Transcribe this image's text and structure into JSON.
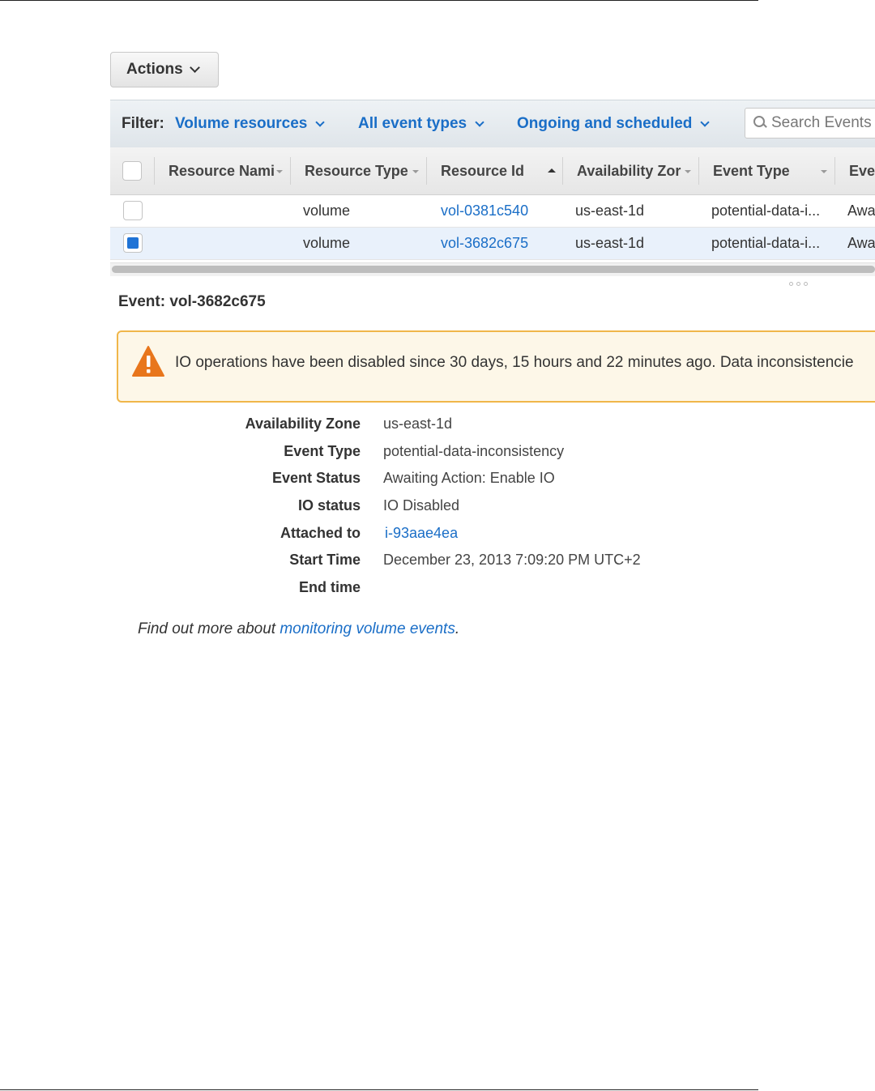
{
  "toolbar": {
    "actions_label": "Actions"
  },
  "filter": {
    "label": "Filter:",
    "resources": "Volume resources",
    "event_types": "All event types",
    "status": "Ongoing and scheduled",
    "search_placeholder": "Search Events"
  },
  "table": {
    "headers": {
      "resource_name": "Resource Nami",
      "resource_type": "Resource Type",
      "resource_id": "Resource Id",
      "availability_zone": "Availability Zor",
      "event_type": "Event Type",
      "event_status": "Eve"
    },
    "rows": [
      {
        "selected": false,
        "resource_name": "",
        "resource_type": "volume",
        "resource_id": "vol-0381c540",
        "availability_zone": "us-east-1d",
        "event_type": "potential-data-i...",
        "event_status": "Awa"
      },
      {
        "selected": true,
        "resource_name": "",
        "resource_type": "volume",
        "resource_id": "vol-3682c675",
        "availability_zone": "us-east-1d",
        "event_type": "potential-data-i...",
        "event_status": "Awa"
      }
    ]
  },
  "event": {
    "title": "Event: vol-3682c675",
    "warning": "IO operations have been disabled since 30 days, 15 hours and 22 minutes ago. Data inconsistencie",
    "details": [
      {
        "label": "Availability Zone",
        "value": "us-east-1d"
      },
      {
        "label": "Event Type",
        "value": "potential-data-inconsistency"
      },
      {
        "label": "Event Status",
        "value": "Awaiting Action: Enable IO"
      },
      {
        "label": "IO status",
        "value": "IO Disabled"
      },
      {
        "label": "Attached to",
        "value": "i-93aae4ea"
      },
      {
        "label": "Start Time",
        "value": "December 23, 2013 7:09:20 PM UTC+2"
      },
      {
        "label": "End time",
        "value": ""
      }
    ]
  },
  "footer": {
    "prefix": "Find out more about",
    "link": "monitoring volume events",
    "suffix": "."
  },
  "colors": {
    "link": "#1a6ec7",
    "warning_border": "#f0b64a",
    "warning_bg": "#fdf7e8",
    "warning_icon": "#e8761c",
    "selected_row": "#e9f1fb",
    "checkbox_checked": "#1f73d6"
  },
  "icons": {
    "actions_dropdown": "chevron-down-icon",
    "search": "search-icon",
    "warning": "warning-triangle-icon",
    "sort_asc": "sort-asc-icon"
  }
}
